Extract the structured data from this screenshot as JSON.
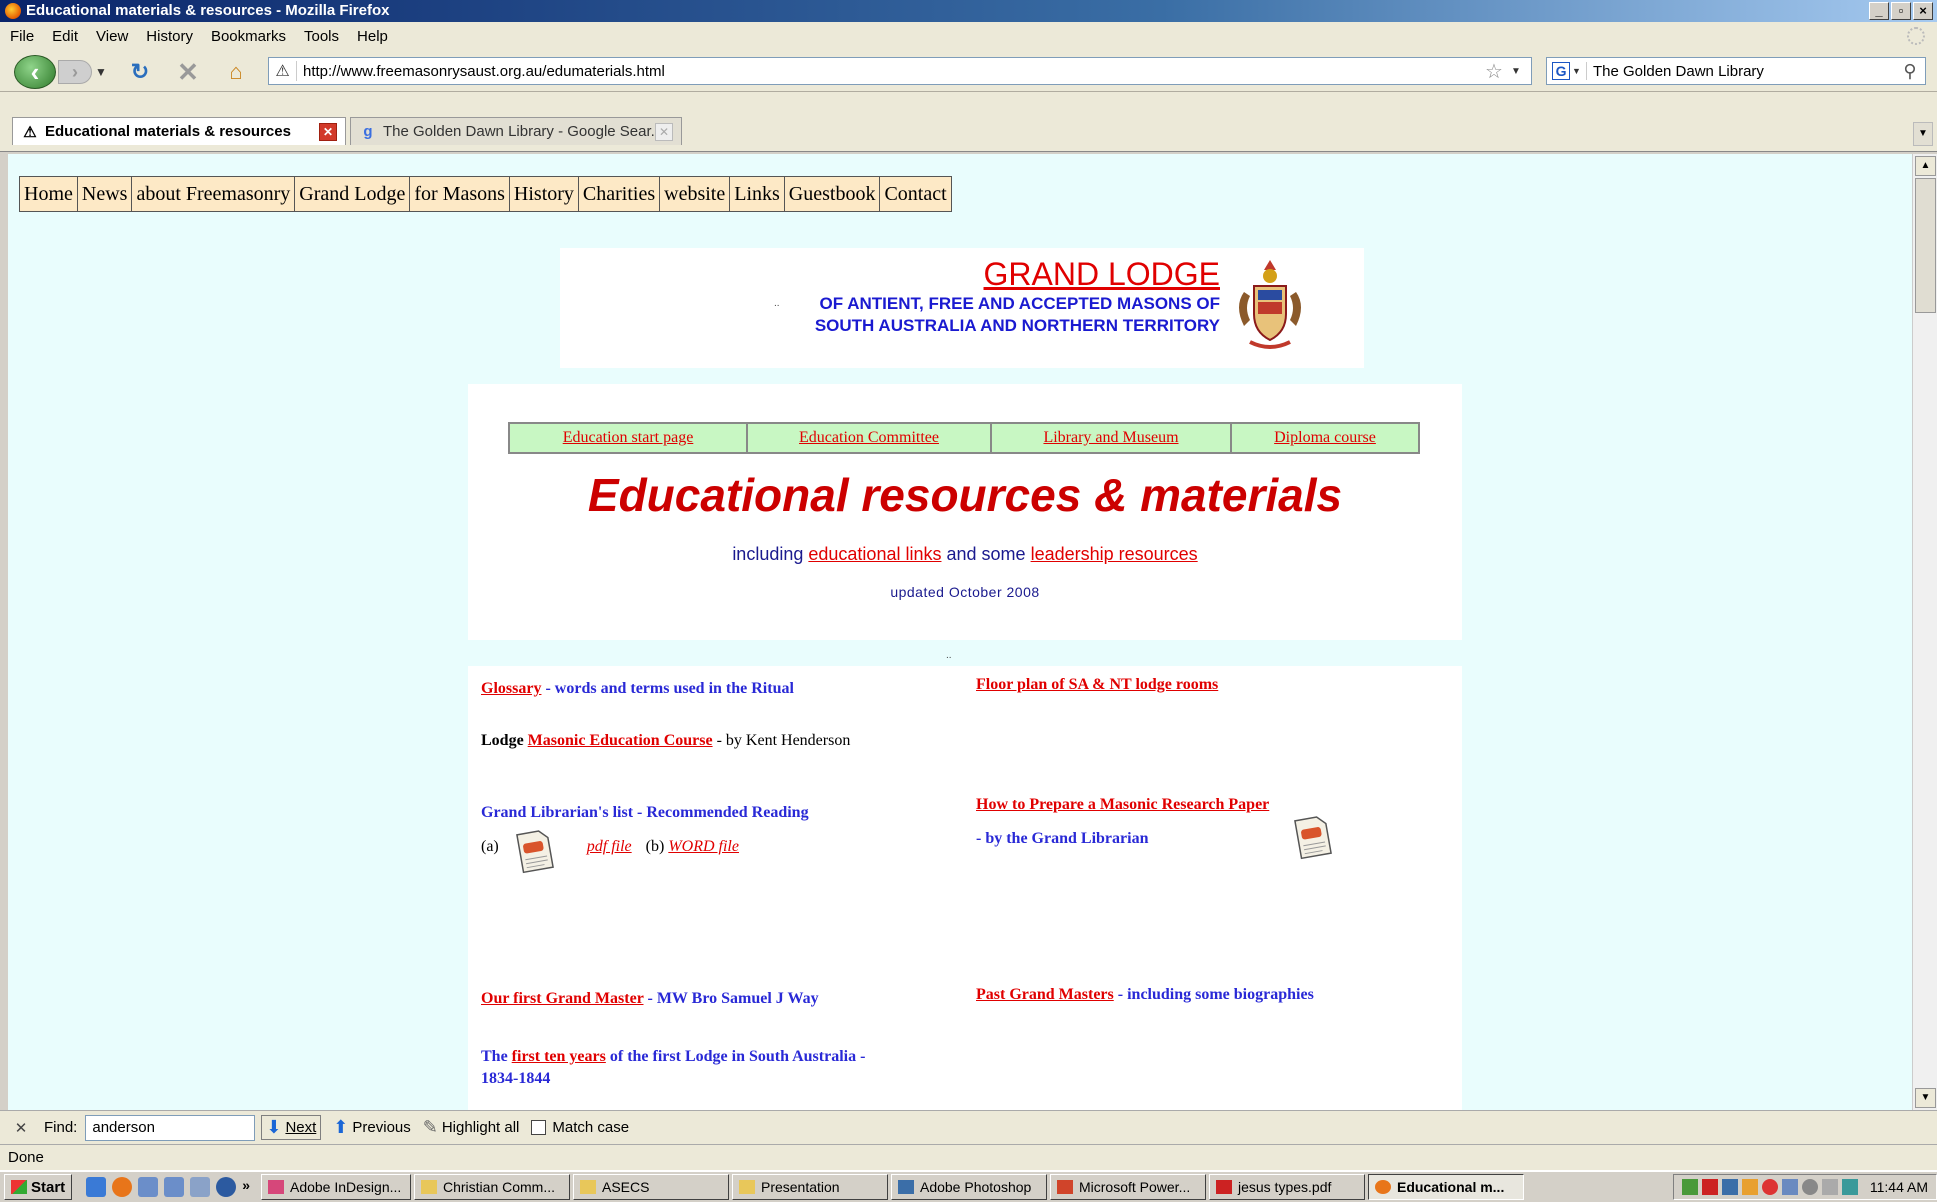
{
  "window": {
    "title": "Educational materials & resources - Mozilla Firefox",
    "controls": [
      "_",
      "▫",
      "×"
    ]
  },
  "menu": [
    "File",
    "Edit",
    "View",
    "History",
    "Bookmarks",
    "Tools",
    "Help"
  ],
  "toolbar": {
    "url": "http://www.freemasonrysaust.org.au/edumaterials.html",
    "search_engine": "G",
    "search_value": "The Golden Dawn Library"
  },
  "tabs": [
    {
      "label": "Educational materials & resources",
      "active": true,
      "icon": "compass-icon"
    },
    {
      "label": "The Golden Dawn Library - Google Sear...",
      "active": false,
      "icon": "google-icon"
    }
  ],
  "site_nav": [
    "Home",
    "News",
    "about Freemasonry",
    "Grand Lodge",
    "for Masons",
    "History",
    "Charities",
    "website",
    "Links",
    "Guestbook",
    "Contact"
  ],
  "header": {
    "title": "GRAND LODGE",
    "sub1": "OF ANTIENT, FREE AND ACCEPTED MASONS OF",
    "sub2": "SOUTH AUSTRALIA AND NORTHERN TERRITORY"
  },
  "separator": "..",
  "edu_nav": [
    "Education start page",
    "Education Committee",
    "Library and Museum",
    "Diploma course"
  ],
  "edu": {
    "title": "Educational resources & materials",
    "sub_prefix": "including",
    "sub_link1": "educational links",
    "sub_mid": "and some",
    "sub_link2": "leadership resources",
    "updated": "updated October 2008"
  },
  "resources": {
    "glossary_link": "Glossary",
    "glossary_text": " - words and terms used in the Ritual",
    "floorplan_link": "Floor plan of  SA & NT  lodge rooms",
    "lodge_prefix": "Lodge",
    "course_link": "Masonic Education Course",
    "course_text": " - by Kent Henderson",
    "librarian_list": "Grand Librarian's list - Recommended Reading",
    "opt_a": "(a)",
    "pdf_link": "pdf file",
    "opt_b": "(b)",
    "word_link": "WORD file",
    "research_link": "How to Prepare a Masonic Research Paper",
    "research_text": "- by the Grand Librarian",
    "first_gm_link": "Our first Grand Master",
    "first_gm_text": " - MW Bro Samuel J Way",
    "past_gm_link": "Past Grand Masters",
    "past_gm_text": " - including some biographies",
    "ten_prefix": "The ",
    "ten_link": "first ten years",
    "ten_text": " of the first Lodge in South Australia -",
    "ten_years": "1834-1844"
  },
  "findbar": {
    "label": "Find:",
    "value": "anderson",
    "next": "Next",
    "previous": "Previous",
    "highlight": "Highlight all",
    "match_case": "Match case"
  },
  "status": "Done",
  "taskbar": {
    "start": "Start",
    "more": "»",
    "items": [
      "Adobe InDesign...",
      "Christian Comm...",
      "ASECS",
      "Presentation",
      "Adobe Photoshop",
      "Microsoft Power...",
      "jesus types.pdf",
      "Educational m..."
    ],
    "clock": "11:44 AM"
  },
  "colors": {
    "page_bg": "#e9fdfd",
    "link_red": "#e00000",
    "title_red": "#cc0000",
    "text_blue": "#2929d6",
    "site_nav_bg": "#fde9c6",
    "edu_nav_bg": "#c8f7c3"
  }
}
